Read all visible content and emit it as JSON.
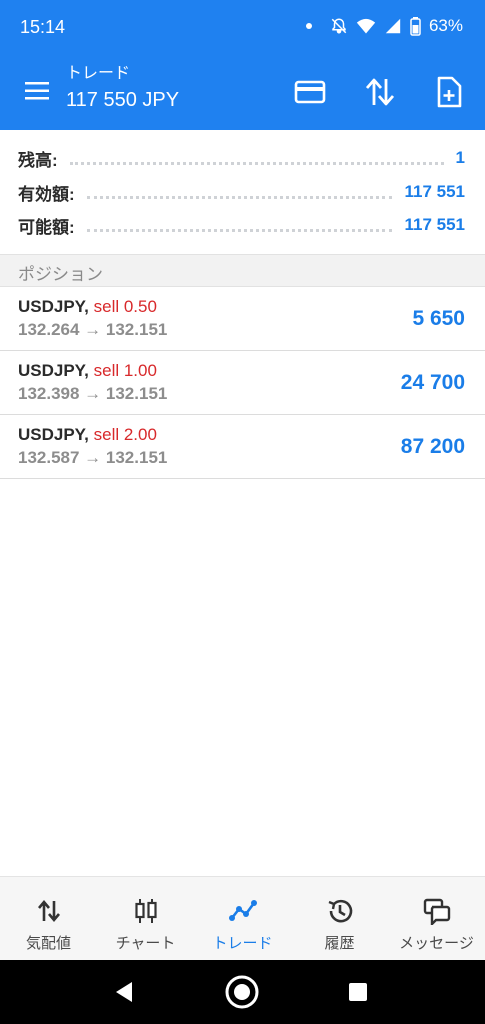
{
  "status_bar": {
    "time": "15:14",
    "battery": "63%"
  },
  "header": {
    "subtitle": "トレード",
    "balance_title": "117 550 JPY"
  },
  "summary": [
    {
      "label": "残高:",
      "value": "1"
    },
    {
      "label": "有効額:",
      "value": "117 551"
    },
    {
      "label": "可能額:",
      "value": "117 551"
    }
  ],
  "positions_section": {
    "title": "ポジション"
  },
  "positions": [
    {
      "symbol": "USDJPY,",
      "side": "sell 0.50",
      "prices": "132.264 → 132.151",
      "profit": "5 650"
    },
    {
      "symbol": "USDJPY,",
      "side": "sell 1.00",
      "prices": "132.398 → 132.151",
      "profit": "24 700"
    },
    {
      "symbol": "USDJPY,",
      "side": "sell 2.00",
      "prices": "132.587 → 132.151",
      "profit": "87 200"
    }
  ],
  "bottom_nav": [
    {
      "label": "気配値",
      "icon": "quotes-icon"
    },
    {
      "label": "チャート",
      "icon": "candlestick-chart-icon"
    },
    {
      "label": "トレード",
      "icon": "trade-line-icon",
      "active": true
    },
    {
      "label": "履歴",
      "icon": "history-icon"
    },
    {
      "label": "メッセージ",
      "icon": "messages-icon"
    }
  ],
  "colors": {
    "accent": "#1f81f0",
    "profit": "#1a7de8",
    "sell": "#d8292b"
  }
}
